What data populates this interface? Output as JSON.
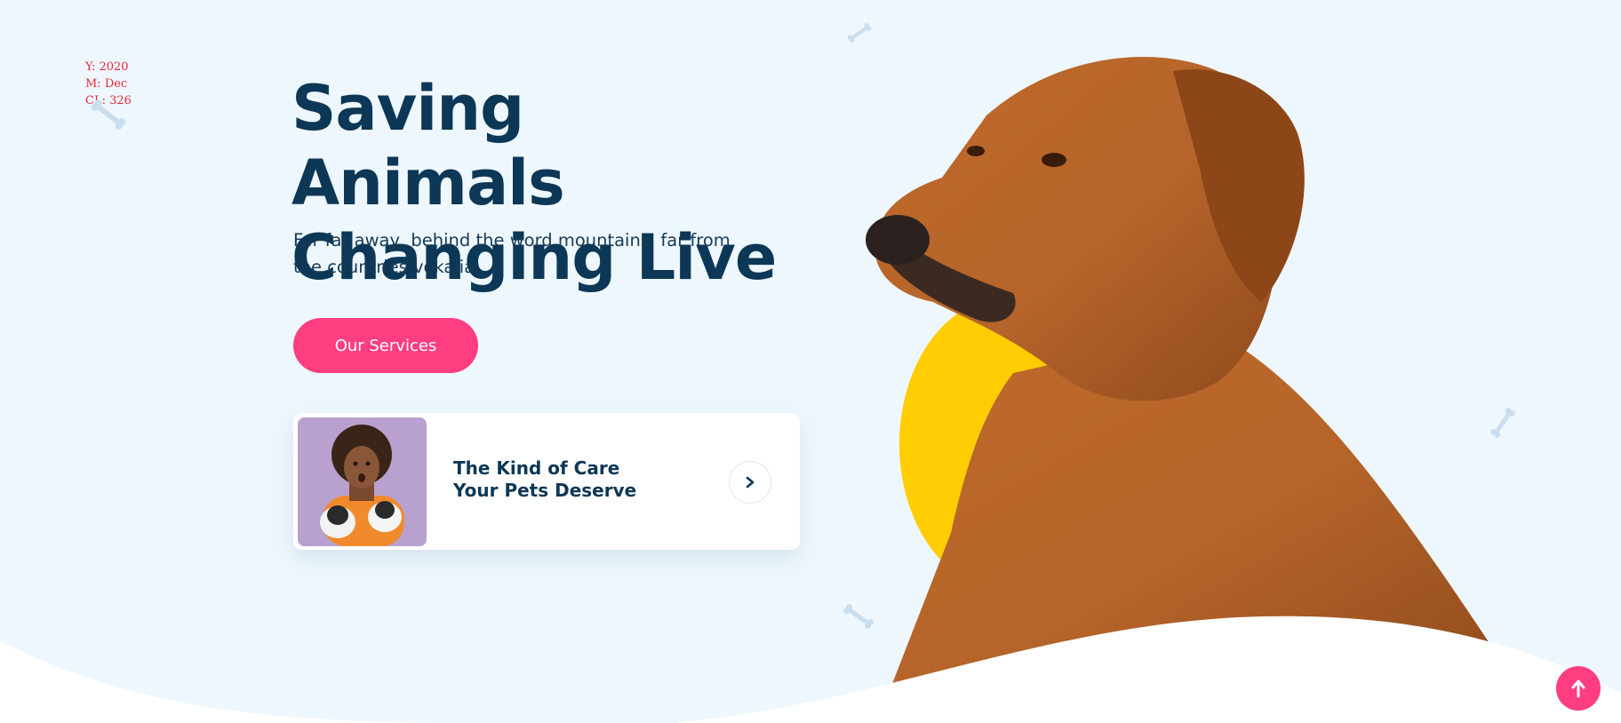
{
  "meta": {
    "year_line": "Y: 2020",
    "month_line": "M: Dec",
    "cl_line": "CL: 326"
  },
  "hero": {
    "title_line1": "Saving Animals",
    "title_line2": "Changing Live",
    "subtitle": "Far far away, behind the word mountains, far from the countries vokalia.",
    "cta_label": "Our Services"
  },
  "card": {
    "title": "The Kind of Care Your Pets Deserve",
    "arrow_icon": "chevron-right-icon"
  },
  "icons": {
    "decor": "bone-icon",
    "scroll_top": "arrow-up-icon"
  },
  "colors": {
    "background": "#eef7fd",
    "heading": "#0c3756",
    "accent": "#ff3d81",
    "sun": "#ffcd02",
    "dog": "#b5642a",
    "meta_text": "#e8283c"
  }
}
